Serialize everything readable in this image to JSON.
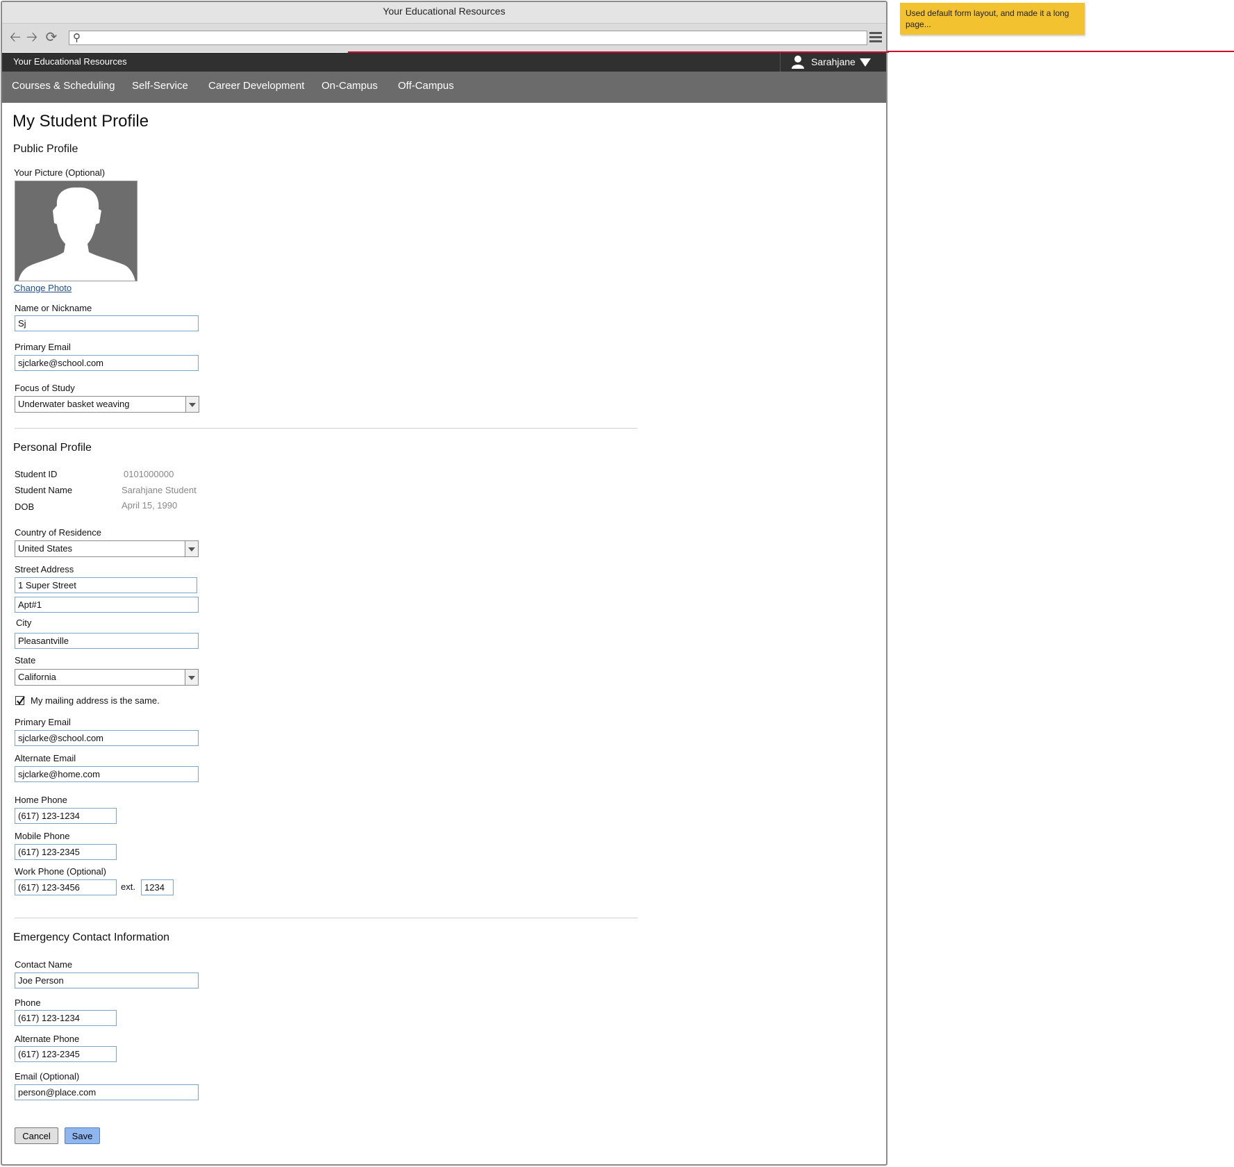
{
  "browser": {
    "title": "Your Educational Resources",
    "address": ""
  },
  "site": {
    "brand": "Your Educational Resources",
    "user_name": "Sarahjane"
  },
  "nav": {
    "items": [
      "Courses & Scheduling",
      "Self-Service",
      "Career Development",
      "On-Campus",
      "Off-Campus"
    ]
  },
  "page": {
    "title": "My Student Profile"
  },
  "public_profile": {
    "heading": "Public Profile",
    "picture_label": "Your Picture (Optional)",
    "change_photo": "Change Photo",
    "name_label": "Name or Nickname",
    "name_value": "Sj",
    "email_label": "Primary Email",
    "email_value": "sjclarke@school.com",
    "focus_label": "Focus of Study",
    "focus_value": "Underwater basket weaving"
  },
  "personal_profile": {
    "heading": "Personal Profile",
    "student_id_label": "Student ID",
    "student_id_value": "0101000000",
    "student_name_label": "Student Name",
    "student_name_value": "Sarahjane Student",
    "dob_label": "DOB",
    "dob_value": "April 15, 1990",
    "country_label": "Country of Residence",
    "country_value": "United States",
    "street_label": "Street Address",
    "street1_value": "1 Super Street",
    "street2_value": "Apt#1",
    "city_label": "City",
    "city_value": "Pleasantville",
    "state_label": "State",
    "state_value": "California",
    "mailing_same_label": "My mailing address is the same.",
    "mailing_same_checked": true,
    "primary_email_label": "Primary Email",
    "primary_email_value": "sjclarke@school.com",
    "alt_email_label": "Alternate Email",
    "alt_email_value": "sjclarke@home.com",
    "home_phone_label": "Home Phone",
    "home_phone_value": "(617) 123-1234",
    "mobile_phone_label": "Mobile Phone",
    "mobile_phone_value": "(617) 123-2345",
    "work_phone_label": "Work Phone (Optional)",
    "work_phone_value": "(617) 123-3456",
    "ext_label": "ext.",
    "ext_value": "1234"
  },
  "emergency": {
    "heading": "Emergency Contact Information",
    "contact_name_label": "Contact Name",
    "contact_name_value": "Joe Person",
    "phone_label": "Phone",
    "phone_value": "(617) 123-1234",
    "alt_phone_label": "Alternate Phone",
    "alt_phone_value": "(617) 123-2345",
    "email_label": "Email (Optional)",
    "email_value": "person@place.com"
  },
  "actions": {
    "cancel": "Cancel",
    "save": "Save"
  },
  "annotation": {
    "note": "Used default form layout, and made it a long page..."
  },
  "colors": {
    "accent_line": "#c8102e",
    "topbar": "#303030",
    "nav": "#6b6b6b",
    "save_button": "#8fb6ee",
    "sticky_note": "#f2c230"
  }
}
